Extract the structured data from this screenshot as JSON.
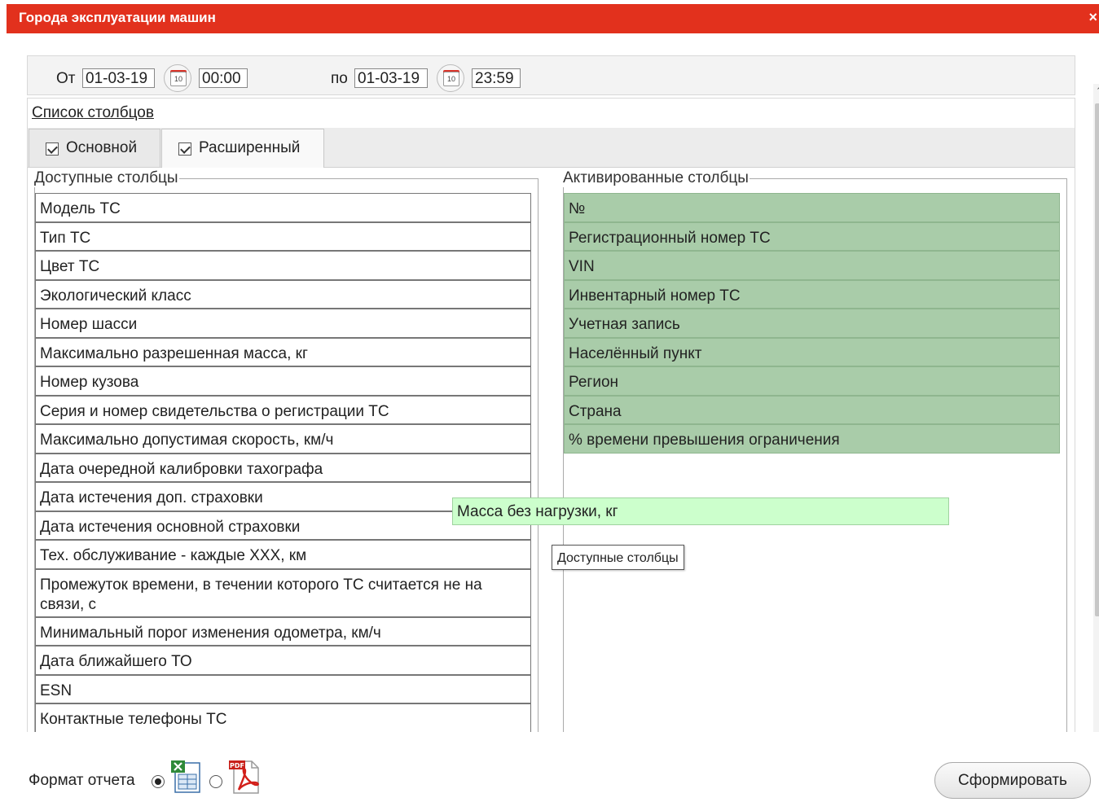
{
  "window": {
    "title": "Города эксплуатации машин",
    "close_glyph": "×"
  },
  "date_range": {
    "from_label": "От",
    "from_date": "01-03-19",
    "from_time": "00:00",
    "to_label": "по",
    "to_date": "01-03-19",
    "to_time": "23:59",
    "calendar_day": "10"
  },
  "columns": {
    "link": "Список столбцов",
    "tabs": [
      {
        "label": "Основной",
        "checked": true,
        "active": false
      },
      {
        "label": "Расширенный",
        "checked": true,
        "active": true
      }
    ],
    "available_legend": "Доступные столбцы",
    "active_legend": "Активированные столбцы",
    "available": [
      "Модель ТС",
      "Тип ТС",
      "Цвет ТС",
      "Экологический класс",
      "Номер шасси",
      "Максимально разрешенная масса, кг",
      "Номер кузова",
      "Серия и номер свидетельства о регистрации ТС",
      "Максимально допустимая скорость, км/ч",
      "Дата очередной калибровки тахографа",
      "Дата истечения доп. страховки",
      "Дата истечения основной страховки",
      "Тех. обслуживание - каждые XXX, км",
      "Промежуток времени, в течении которого ТС считается не на связи, с",
      "Минимальный порог изменения одометра, км/ч",
      "Дата ближайшего ТО",
      "ESN",
      "Контактные телефоны ТС"
    ],
    "activated": [
      "№",
      "Регистрационный номер ТС",
      "VIN",
      "Инвентарный номер ТС",
      "Учетная запись",
      "Населённый пункт",
      "Регион",
      "Страна",
      "% времени превышения ограничения"
    ],
    "dragging": "Масса без нагрузки, кг",
    "tooltip": "Доступные столбцы"
  },
  "footer": {
    "format_label": "Формат отчета",
    "selected_format": "xls",
    "submit": "Сформировать"
  },
  "colors": {
    "titlebar": "#e2311d",
    "active_row": "#a9cca9",
    "drag_row": "#ccffcc"
  }
}
